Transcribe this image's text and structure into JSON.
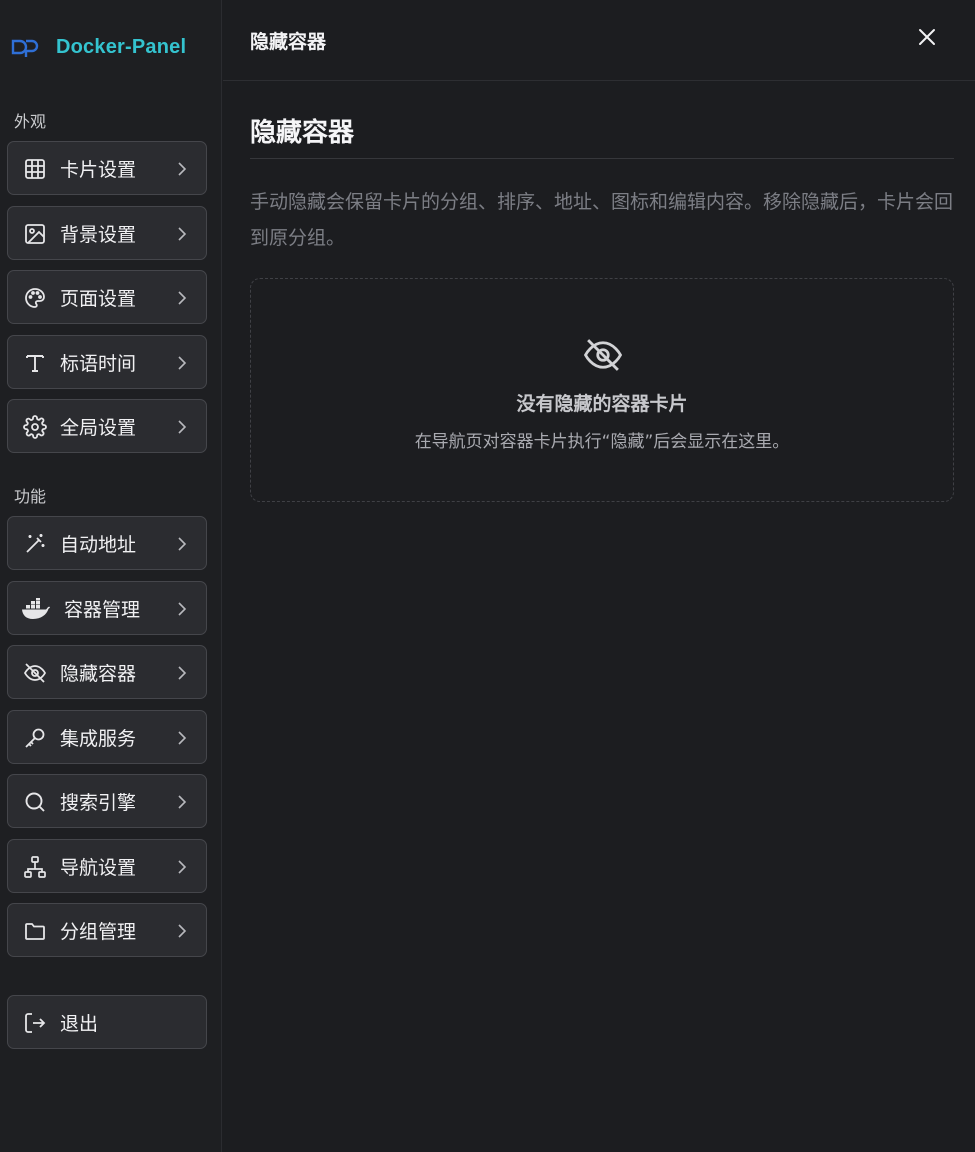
{
  "brand": {
    "name": "Docker-Panel",
    "accent": "#34c3cf"
  },
  "sidebar": {
    "sections": [
      {
        "label": "外观",
        "items": [
          {
            "label": "卡片设置",
            "icon": "grid-icon"
          },
          {
            "label": "背景设置",
            "icon": "image-icon"
          },
          {
            "label": "页面设置",
            "icon": "palette-icon"
          },
          {
            "label": "标语时间",
            "icon": "type-icon"
          },
          {
            "label": "全局设置",
            "icon": "gear-icon"
          }
        ]
      },
      {
        "label": "功能",
        "items": [
          {
            "label": "自动地址",
            "icon": "magic-wand-icon"
          },
          {
            "label": "容器管理",
            "icon": "docker-whale-icon"
          },
          {
            "label": "隐藏容器",
            "icon": "eye-off-icon"
          },
          {
            "label": "集成服务",
            "icon": "key-icon"
          },
          {
            "label": "搜索引擎",
            "icon": "search-icon"
          },
          {
            "label": "导航设置",
            "icon": "sitemap-icon"
          },
          {
            "label": "分组管理",
            "icon": "folder-icon"
          }
        ]
      }
    ],
    "logout": {
      "label": "退出",
      "icon": "logout-icon"
    }
  },
  "main": {
    "topbar_title": "隐藏容器",
    "page_title": "隐藏容器",
    "description": "手动隐藏会保留卡片的分组、排序、地址、图标和编辑内容。移除隐藏后，卡片会回到原分组。",
    "empty_state": {
      "icon": "eye-off-icon",
      "title": "没有隐藏的容器卡片",
      "hint": "在导航页对容器卡片执行“隐藏”后会显示在这里。"
    }
  }
}
